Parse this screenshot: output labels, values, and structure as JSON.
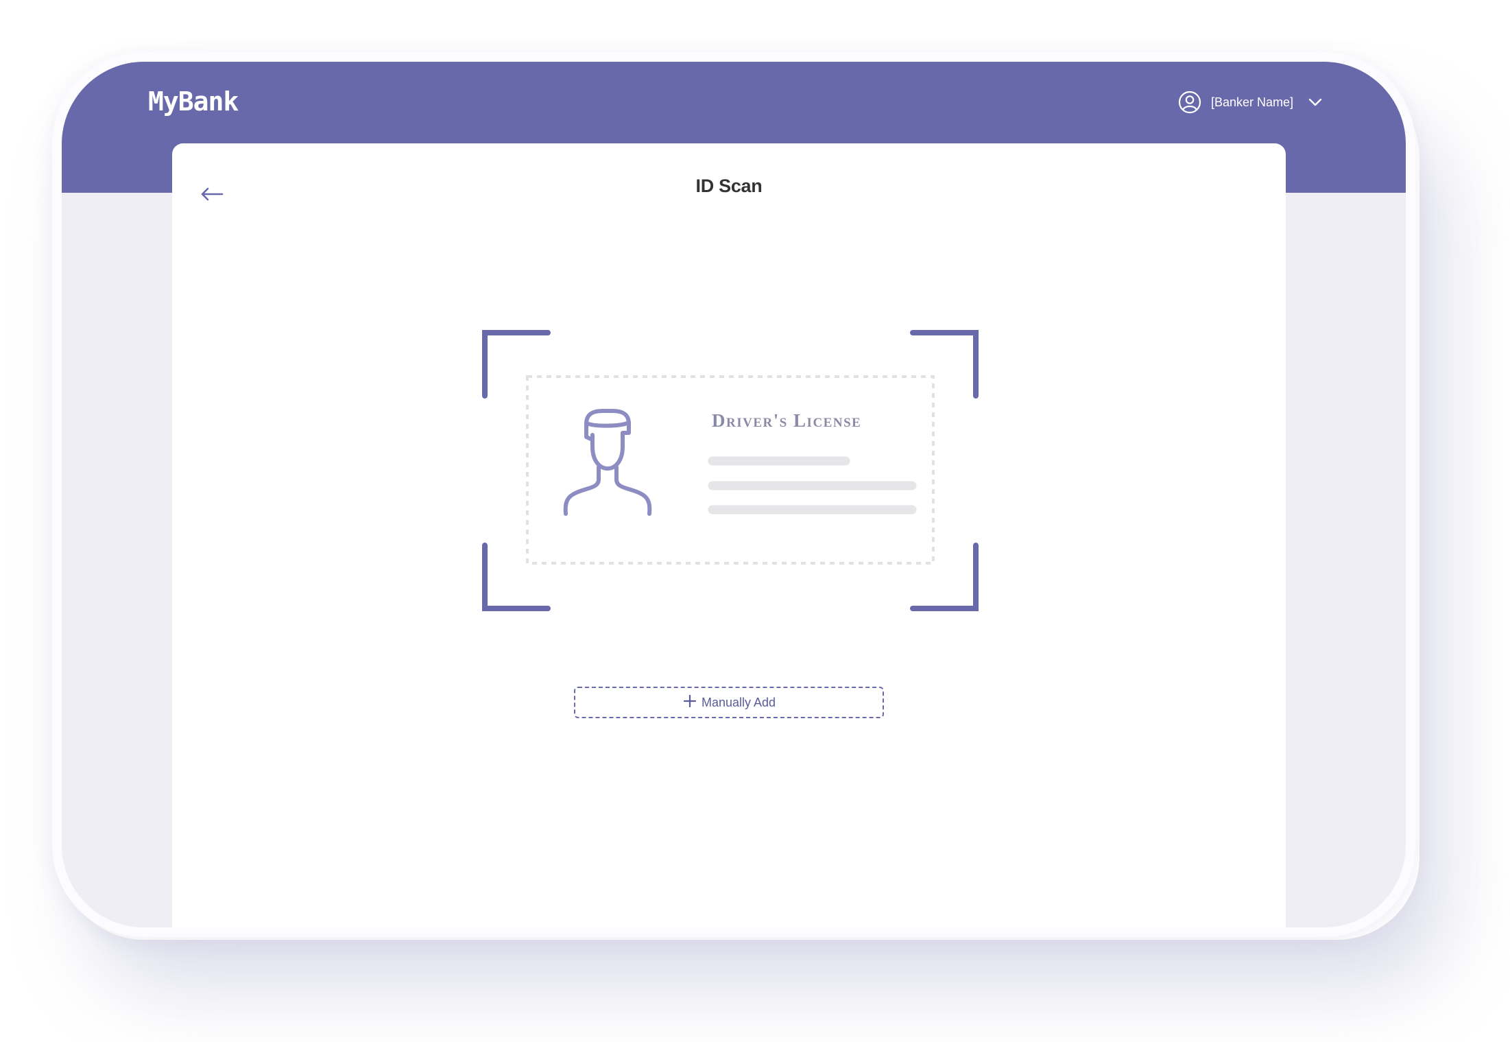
{
  "app": {
    "brand": "MyBank"
  },
  "header": {
    "user_name": "[Banker Name]",
    "user_icon": "user-circle-icon",
    "dropdown_icon": "chevron-down-icon"
  },
  "page": {
    "title": "ID Scan",
    "back_icon": "arrow-left-icon"
  },
  "scan": {
    "card_title": "Driver's License",
    "portrait_icon": "person-portrait-icon"
  },
  "actions": {
    "manual_add_label": "Manually Add",
    "manual_add_icon": "plus-icon"
  },
  "colors": {
    "primary": "#6869ab",
    "background": "#eeeef4",
    "panel": "#ffffff",
    "placeholder_line": "#e6e6e9",
    "card_border": "#e1e1e4"
  }
}
